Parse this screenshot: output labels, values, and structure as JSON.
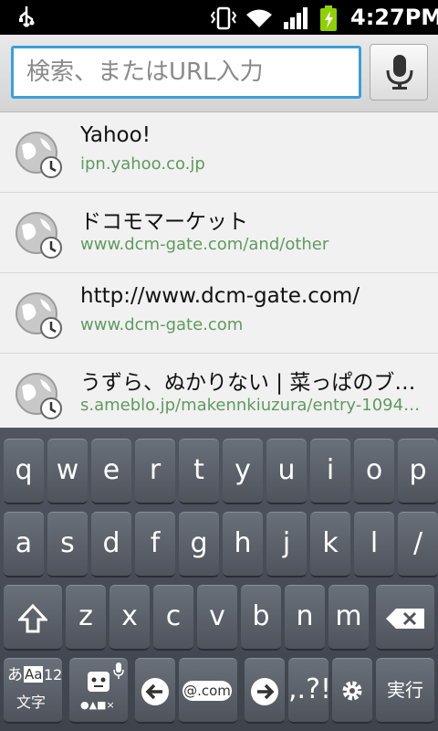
{
  "status": {
    "time": "4:27PM",
    "icons": [
      "usb-icon",
      "vibrate-icon",
      "wifi-icon",
      "signal-icon",
      "battery-charging-icon"
    ]
  },
  "urlbar": {
    "placeholder": "検索、またはURL入力"
  },
  "suggestions": [
    {
      "title": "Yahoo!",
      "url": "ipn.yahoo.co.jp"
    },
    {
      "title": "ドコモマーケット",
      "url": "www.dcm-gate.com/and/other"
    },
    {
      "title": "http://www.dcm-gate.com/",
      "url": "www.dcm-gate.com"
    },
    {
      "title": "うずら、ぬかりない | 菜っぱのブ…",
      "url": "s.ameblo.jp/makennkiuzura/entry-1094…"
    }
  ],
  "keyboard": {
    "row1": [
      "q",
      "w",
      "e",
      "r",
      "t",
      "y",
      "u",
      "i",
      "o",
      "p"
    ],
    "row2": [
      "a",
      "s",
      "d",
      "f",
      "g",
      "h",
      "j",
      "k",
      "l",
      "/"
    ],
    "row3": [
      "z",
      "x",
      "c",
      "v",
      "b",
      "n",
      "m"
    ],
    "mode_top": "あ",
    "mode_mid": "Aa",
    "mode_num": "12",
    "mode_bottom": "文字",
    "emoji_sub": "●▲■×",
    "dotcom": "@.com",
    "punct": ",.?!",
    "enter": "実行"
  }
}
